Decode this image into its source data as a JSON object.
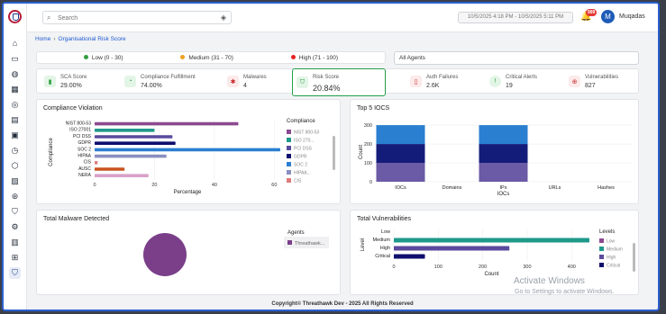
{
  "topbar": {
    "search_placeholder": "Search",
    "date_range": "10/5/2025 4:18 PM - 10/5/2025 5:11 PM",
    "notification_count": "999",
    "avatar_initial": "M",
    "username": "Muqadas"
  },
  "breadcrumb": {
    "home": "Home",
    "current": "Organisational Risk Score"
  },
  "risk_legend": [
    {
      "label": "Low (0 - 30)",
      "color": "#2e9e3f"
    },
    {
      "label": "Medium (31 - 70)",
      "color": "#f0a020"
    },
    {
      "label": "High (71 - 100)",
      "color": "#e52222"
    }
  ],
  "agent_select": {
    "value": "All Agents"
  },
  "metrics": [
    {
      "label": "SCA Score",
      "value": "29.00%",
      "icon": "bar-chart-icon",
      "color": "#2e9e3f",
      "bg": "#e3f5e6"
    },
    {
      "label": "Compliance Fulfillment",
      "value": "74.00%",
      "icon": "gauge-icon",
      "color": "#2e9e3f",
      "bg": "#e3f5e6"
    },
    {
      "label": "Malwares",
      "value": "4",
      "icon": "bug-icon",
      "color": "#c62828",
      "bg": "#fdeaea"
    },
    {
      "label": "Risk Score",
      "value": "20.84%",
      "icon": "shield-icon",
      "color": "#2e9e3f",
      "bg": "#e3f5e6"
    },
    {
      "label": "Auth Failures",
      "value": "2.6K",
      "icon": "lock-icon",
      "color": "#c62828",
      "bg": "#fdeaea"
    },
    {
      "label": "Critical Alerts",
      "value": "19",
      "icon": "alert-icon",
      "color": "#2e9e3f",
      "bg": "#e3f5e6"
    },
    {
      "label": "Vulnerabilities",
      "value": "827",
      "icon": "target-icon",
      "color": "#c62828",
      "bg": "#fdeaea"
    }
  ],
  "compliance_panel": {
    "title": "Compliance Violation",
    "legend_title": "Compliance",
    "legend": [
      "NIST 800-53",
      "ISO 270...",
      "PCI DSS",
      "GDPR",
      "SOC 2",
      "HIPAA...",
      "CIS"
    ]
  },
  "iocs_panel": {
    "title": "Top 5 IOCS"
  },
  "malware_panel": {
    "title": "Total Malware Detected",
    "legend_title": "Agents",
    "legend": [
      "Threathawk..."
    ],
    "colors": [
      "#7b3f8a"
    ]
  },
  "vuln_panel": {
    "title": "Total Vulnerabilities",
    "legend_title": "Levels",
    "legend": [
      "Low",
      "Medium",
      "High",
      "Critical"
    ]
  },
  "footer": "Copyright© Threathawk Dev - 2025 All Rights Reserved",
  "watermark": {
    "line1": "Activate Windows",
    "line2": "Go to Settings to activate Windows."
  },
  "chart_data": [
    {
      "type": "bar",
      "orientation": "horizontal",
      "title": "Compliance Violation",
      "xlabel": "Percentage",
      "ylabel": "Compliance",
      "categories": [
        "NIST 800-53",
        "ISO 27001",
        "PCI DSS",
        "GDPR",
        "SOC 2",
        "HIPAA",
        "CIS",
        "AUSC",
        "NERA"
      ],
      "values": [
        48,
        20,
        26,
        27,
        62,
        24,
        1,
        10,
        18
      ],
      "colors": [
        "#8b4a8f",
        "#1f9a8a",
        "#5a4a9e",
        "#0f0f6e",
        "#2a7fd0",
        "#8a8fc0",
        "#e07a7a",
        "#c8521f",
        "#d8a0c8"
      ],
      "xticks": [
        0,
        20,
        40,
        60
      ],
      "xlim": [
        0,
        62
      ]
    },
    {
      "type": "bar",
      "stacked": true,
      "title": "Top 5 IOCS",
      "xlabel": "IOCs",
      "ylabel": "Count",
      "categories": [
        "IOCs",
        "Domains",
        "IPs",
        "URLs",
        "Hashes"
      ],
      "series": [
        {
          "values": [
            100,
            0,
            100,
            0,
            0
          ],
          "color": "#6b5aa6"
        },
        {
          "values": [
            100,
            0,
            100,
            0,
            0
          ],
          "color": "#141c7a"
        },
        {
          "values": [
            100,
            0,
            100,
            0,
            0
          ],
          "color": "#2a7fd0"
        }
      ],
      "yticks": [
        0,
        100,
        200,
        300
      ],
      "ylim": [
        0,
        310
      ]
    },
    {
      "type": "pie",
      "title": "Total Malware Detected",
      "labels": [
        "Threathawk..."
      ],
      "values": [
        4
      ],
      "colors": [
        "#7b3f8a"
      ]
    },
    {
      "type": "bar",
      "orientation": "horizontal",
      "title": "Total Vulnerabilities",
      "xlabel": "Count",
      "ylabel": "Level",
      "categories": [
        "Low",
        "Medium",
        "High",
        "Critical"
      ],
      "values": [
        0,
        440,
        260,
        70
      ],
      "colors": [
        "#8b4a8f",
        "#1f9a8a",
        "#5a4a9e",
        "#0f0f6e"
      ],
      "xticks": [
        0,
        100,
        200,
        300,
        400
      ],
      "xlim": [
        0,
        440
      ]
    }
  ]
}
